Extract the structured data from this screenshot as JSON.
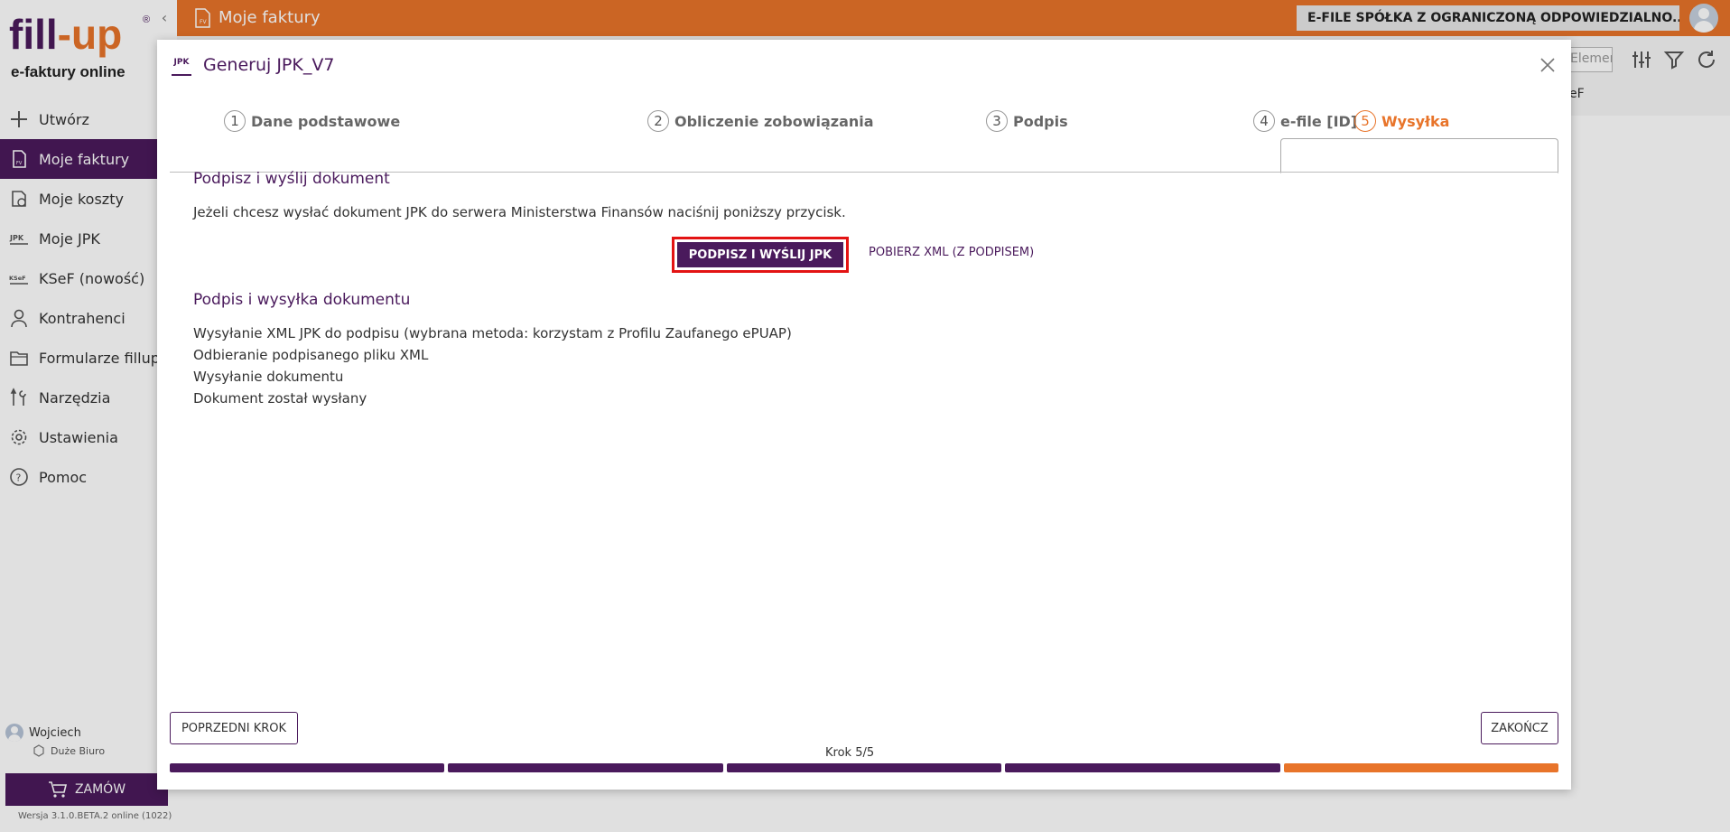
{
  "brand": {
    "logo_part1": "fill",
    "logo_dash": "-",
    "logo_part2": "up",
    "reg": "®",
    "subtitle": "e-faktury online",
    "collapse": "‹"
  },
  "sidebar": {
    "items": [
      {
        "label": "Utwórz",
        "icon": "plus-icon"
      },
      {
        "label": "Moje faktury",
        "icon": "invoice-icon"
      },
      {
        "label": "Moje koszty",
        "icon": "costs-icon"
      },
      {
        "label": "Moje JPK",
        "icon": "jpk-icon"
      },
      {
        "label": "KSeF (nowość)",
        "icon": "ksef-icon"
      },
      {
        "label": "Kontrahenci",
        "icon": "person-icon"
      },
      {
        "label": "Formularze fillup",
        "icon": "folder-icon"
      },
      {
        "label": "Narzędzia",
        "icon": "tools-icon"
      },
      {
        "label": "Ustawienia",
        "icon": "gear-icon"
      },
      {
        "label": "Pomoc",
        "icon": "help-icon"
      }
    ],
    "user_name": "Wojciech",
    "plan": "Duże Biuro",
    "order_label": "ZAMÓW",
    "version": "Wersja 3.1.0.BETA.2 online (1022)"
  },
  "topbar": {
    "title": "Moje faktury",
    "company": "E-FILE SPÓŁKA Z OGRANICZONĄ ODPOWIEDZIALNO..."
  },
  "background": {
    "search_placeholder": "Elemen",
    "ksef_fragment": "eF"
  },
  "modal": {
    "icon_text": "JPK",
    "title": "Generuj JPK_V7",
    "steps": [
      {
        "num": "1",
        "label": "Dane podstawowe"
      },
      {
        "num": "2",
        "label": "Obliczenie zobowiązania"
      },
      {
        "num": "3",
        "label": "Podpis"
      },
      {
        "num": "4",
        "label": "e-file [ID]"
      },
      {
        "num": "5",
        "label": "Wysyłka"
      }
    ],
    "section1_title": "Podpisz i wyślij dokument",
    "section1_text": "Jeżeli chcesz wysłać dokument JPK do serwera Ministerstwa Finansów naciśnij poniższy przycisk.",
    "sign_button": "PODPISZ I WYŚLIJ JPK",
    "download_link": "POBIERZ XML (Z PODPISEM)",
    "section2_title": "Podpis i wysyłka dokumentu",
    "log": [
      "Wysyłanie XML JPK do podpisu (wybrana metoda: korzystam z Profilu Zaufanego ePUAP)",
      "Odbieranie podpisanego pliku XML",
      "Wysyłanie dokumentu",
      "Dokument został wysłany"
    ],
    "prev_button": "POPRZEDNI KROK",
    "finish_button": "ZAKOŃCZ",
    "step_counter": "Krok 5/5",
    "progress_current": 5,
    "progress_total": 5
  },
  "colors": {
    "brand_purple": "#4a1a5c",
    "brand_orange": "#e8742a",
    "highlight_red": "#e31313"
  }
}
